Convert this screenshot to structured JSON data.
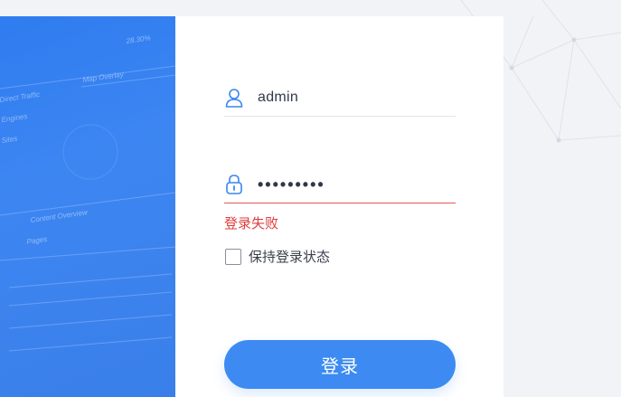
{
  "login": {
    "username_value": "admin",
    "password_value": "•••••••••",
    "error_text": "登录失败",
    "remember_label": "保持登录状态",
    "remember_checked": false,
    "submit_label": "登录"
  },
  "hero": {
    "items": [
      "Map Overlay",
      "Direct Traffic",
      "Engines",
      "Sites",
      "Content Overview",
      "Pages"
    ],
    "figure": "28.30%"
  },
  "colors": {
    "accent": "#3d8bf2",
    "error": "#e03c3c",
    "hero": "#3a7fe9"
  },
  "icons": {
    "username": "user-icon",
    "password": "lock-icon",
    "remember": "checkbox"
  }
}
